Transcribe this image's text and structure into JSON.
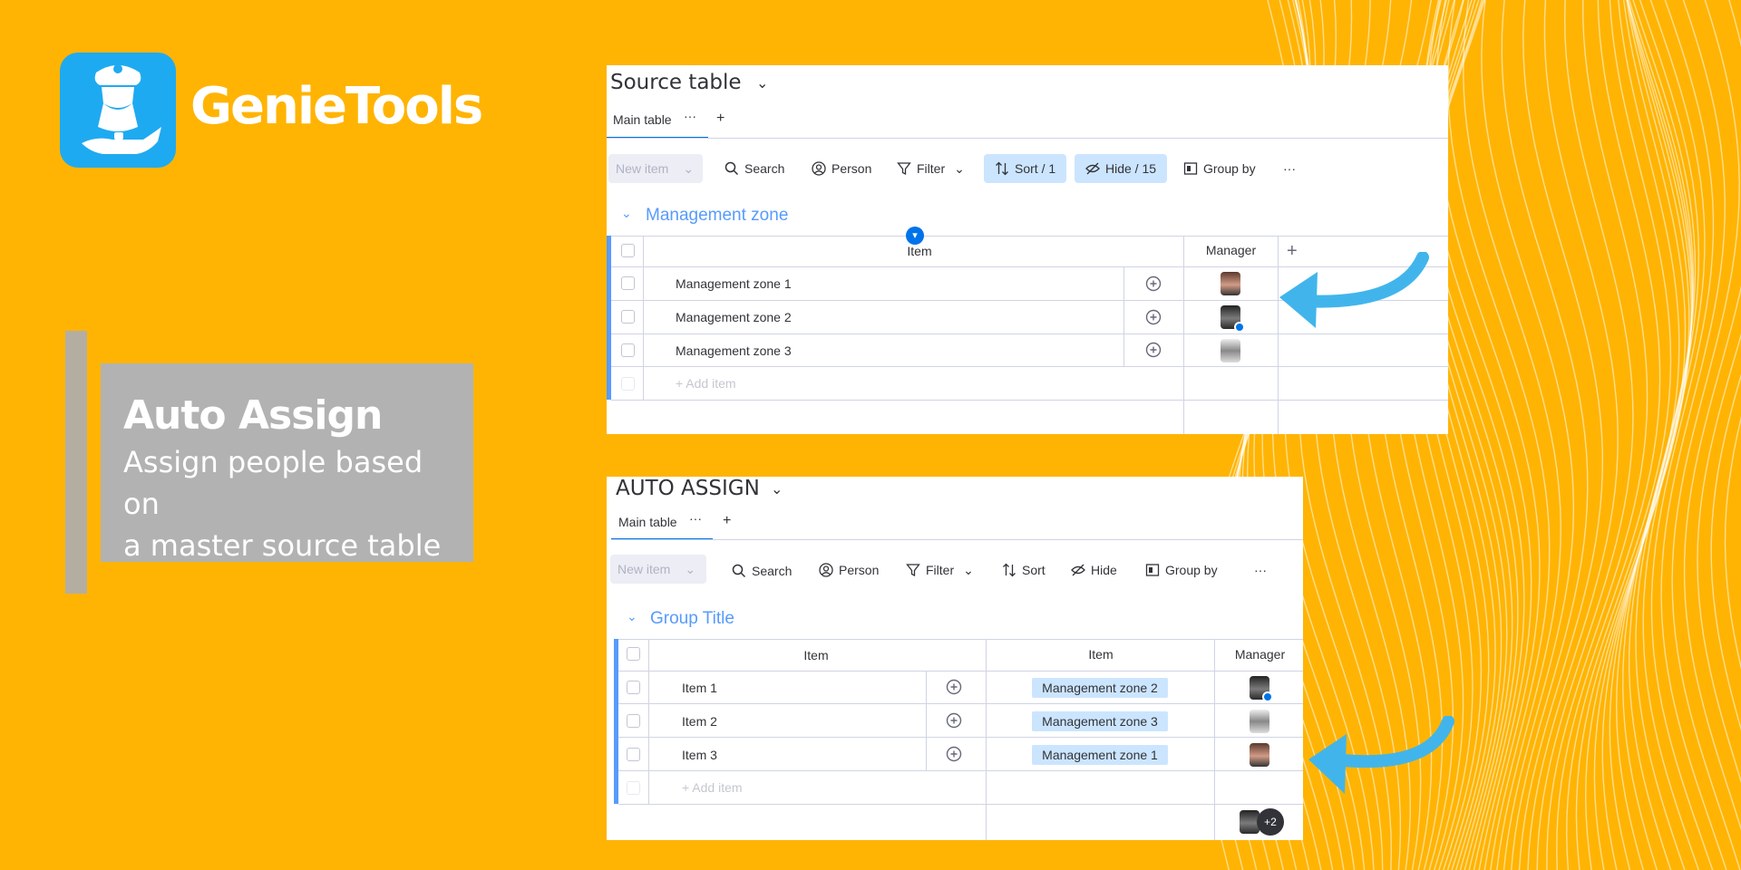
{
  "brand": {
    "name": "GenieTools",
    "logo_icon": "genie-lamp-icon",
    "logo_color": "#1EAAF1"
  },
  "feature": {
    "title": "Auto Assign",
    "description_line1": "Assign people based on",
    "description_line2": "a master source table"
  },
  "colors": {
    "background": "#FFB404",
    "accent": "#579BFC",
    "arrow": "#41B5EB"
  },
  "source_table": {
    "title": "Source table",
    "tab": "Main table",
    "toolbar": {
      "new_item": "New item",
      "search": "Search",
      "person": "Person",
      "filter": "Filter",
      "sort": "Sort / 1",
      "hide": "Hide / 15",
      "group_by": "Group by"
    },
    "group": "Management zone",
    "columns": {
      "item": "Item",
      "manager": "Manager"
    },
    "rows": [
      {
        "name": "Management zone 1",
        "avatar": "person-avatar-1"
      },
      {
        "name": "Management zone 2",
        "avatar": "person-avatar-2"
      },
      {
        "name": "Management zone 3",
        "avatar": "person-avatar-3"
      }
    ],
    "add_item": "+ Add item"
  },
  "auto_assign": {
    "title": "AUTO ASSIGN",
    "tab": "Main table",
    "toolbar": {
      "new_item": "New item",
      "search": "Search",
      "person": "Person",
      "filter": "Filter",
      "sort": "Sort",
      "hide": "Hide",
      "group_by": "Group by"
    },
    "group": "Group Title",
    "columns": {
      "item": "Item",
      "link": "Item",
      "manager": "Manager"
    },
    "rows": [
      {
        "name": "Item 1",
        "zone": "Management zone 2",
        "avatar": "person-avatar-2"
      },
      {
        "name": "Item 2",
        "zone": "Management zone 3",
        "avatar": "person-avatar-3"
      },
      {
        "name": "Item 3",
        "zone": "Management zone 1",
        "avatar": "person-avatar-1"
      }
    ],
    "add_item": "+ Add item",
    "summary_more": "+2"
  }
}
